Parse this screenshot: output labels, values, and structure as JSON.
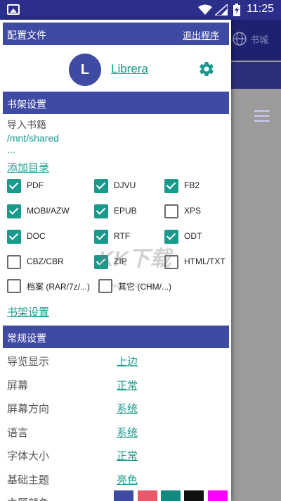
{
  "status": {
    "time": "11:25"
  },
  "background": {
    "store_label": "书城"
  },
  "drawer": {
    "title": "配置文件",
    "exit_label": "退出程序",
    "profile": {
      "avatar_letter": "L",
      "name": "Librera"
    },
    "bookshelf": {
      "section_title": "书架设置",
      "import_label": "导入书籍",
      "path": "/mnt/shared",
      "ellipsis": "...",
      "add_dir": "添加目录",
      "formats": [
        {
          "label": "PDF",
          "checked": true
        },
        {
          "label": "DJVU",
          "checked": true
        },
        {
          "label": "FB2",
          "checked": true
        },
        {
          "label": "MOBI/AZW",
          "checked": true
        },
        {
          "label": "EPUB",
          "checked": true
        },
        {
          "label": "XPS",
          "checked": false
        },
        {
          "label": "DOC",
          "checked": true
        },
        {
          "label": "RTF",
          "checked": true
        },
        {
          "label": "ODT",
          "checked": true
        },
        {
          "label": "CBZ/CBR",
          "checked": false
        },
        {
          "label": "ZIP",
          "checked": true
        },
        {
          "label": "HTML/TXT",
          "checked": false
        },
        {
          "label": "档案 (RAR/7z/...)",
          "checked": false
        },
        {
          "label": "其它 (CHM/...)",
          "checked": false
        }
      ],
      "footer_link": "书架设置"
    },
    "general": {
      "section_title": "常规设置",
      "rows": [
        {
          "label": "导览显示",
          "value": "上边"
        },
        {
          "label": "屏幕",
          "value": "正常"
        },
        {
          "label": "屏幕方向",
          "value": "系统"
        },
        {
          "label": "语言",
          "value": "系统"
        },
        {
          "label": "字体大小",
          "value": "正常"
        },
        {
          "label": "基础主题",
          "value": "亮色"
        },
        {
          "label": "主题颜色",
          "value": ""
        }
      ],
      "theme_colors": [
        "#3f4aa3",
        "#e85a6b",
        "#138a80",
        "#111111",
        "#ff00ff"
      ]
    }
  },
  "watermark": {
    "text": "KK下载",
    "sub": "www.kkx.net"
  }
}
